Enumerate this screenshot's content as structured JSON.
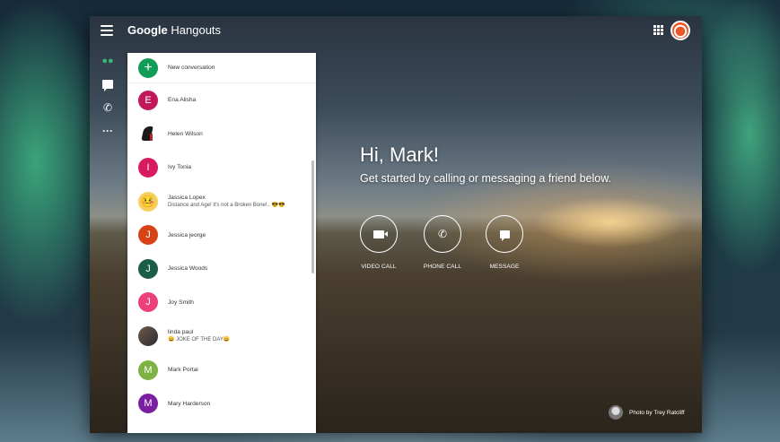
{
  "app": {
    "title_brand": "Google",
    "title_product": " Hangouts"
  },
  "rail": [
    {
      "name": "contacts",
      "icon": "people-icon"
    },
    {
      "name": "conversations",
      "icon": "chat-icon"
    },
    {
      "name": "calls",
      "icon": "phone-icon"
    },
    {
      "name": "more",
      "icon": "more-icon"
    }
  ],
  "panel": {
    "new_conversation": "New conversation",
    "contacts": [
      {
        "name": "Ena Alisha",
        "initial": "E",
        "color": "#c2185b",
        "avatar": "letter"
      },
      {
        "name": "Helen Wilson",
        "initial": "",
        "color": "#ffffff",
        "avatar": "heel-photo"
      },
      {
        "name": "Ivy Tonia",
        "initial": "I",
        "color": "#d81b60",
        "avatar": "letter"
      },
      {
        "name": "Jassica Lopex",
        "subtitle": "Distance and Age! it's not a Broken Bone!.. 😎😎",
        "initial": "🤒",
        "color": "#f4d05a",
        "avatar": "emoji"
      },
      {
        "name": "Jessica jeorge",
        "initial": "J",
        "color": "#d84315",
        "avatar": "letter"
      },
      {
        "name": "Jessica Woods",
        "initial": "J",
        "color": "#1b5e48",
        "avatar": "letter"
      },
      {
        "name": "Joy Smith",
        "initial": "J",
        "color": "#ec407a",
        "avatar": "letter"
      },
      {
        "name": "linda paul",
        "subtitle": "😄 JOKE OF THE DAY😄",
        "initial": "",
        "color": "#5a4a44",
        "avatar": "photo"
      },
      {
        "name": "Mark Portai",
        "initial": "M",
        "color": "#7cb342",
        "avatar": "letter"
      },
      {
        "name": "Mary Harderson",
        "initial": "M",
        "color": "#7b1fa2",
        "avatar": "letter"
      }
    ]
  },
  "main": {
    "greeting": "Hi, Mark!",
    "subtext": "Get started by calling or messaging a friend below.",
    "actions": [
      {
        "label": "VIDEO CALL",
        "icon": "video-icon"
      },
      {
        "label": "PHONE CALL",
        "icon": "phone-icon"
      },
      {
        "label": "MESSAGE",
        "icon": "message-icon"
      }
    ],
    "photo_credit": "Photo by Trey Ratcliff"
  }
}
